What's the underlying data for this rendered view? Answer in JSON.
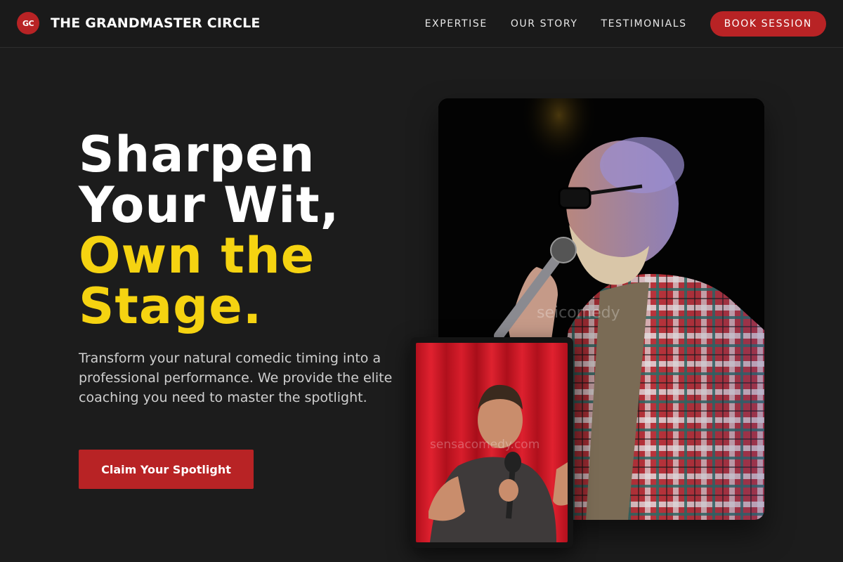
{
  "brand": {
    "logo_initials": "GC",
    "name": "THE GRANDMASTER CIRCLE",
    "accent_color": "#b82325"
  },
  "nav": {
    "links": [
      "EXPERTISE",
      "OUR STORY",
      "TESTIMONIALS"
    ],
    "cta_label": "BOOK SESSION"
  },
  "hero": {
    "title_line1": "Sharpen",
    "title_line2": "Your Wit,",
    "title_line3": "Own the",
    "title_line4": "Stage.",
    "highlight_color": "#f5d311",
    "subtitle": "Transform your natural comedic timing into a professional performance. We provide the elite coaching you need to master the spotlight.",
    "cta_label": "Claim Your Spotlight"
  },
  "images": {
    "main_photo": "comedian-on-stage-photo",
    "main_watermark": "seicomedy",
    "inset_photo": "comedian-red-curtain-photo",
    "inset_watermark": "sensacomedy.com"
  }
}
